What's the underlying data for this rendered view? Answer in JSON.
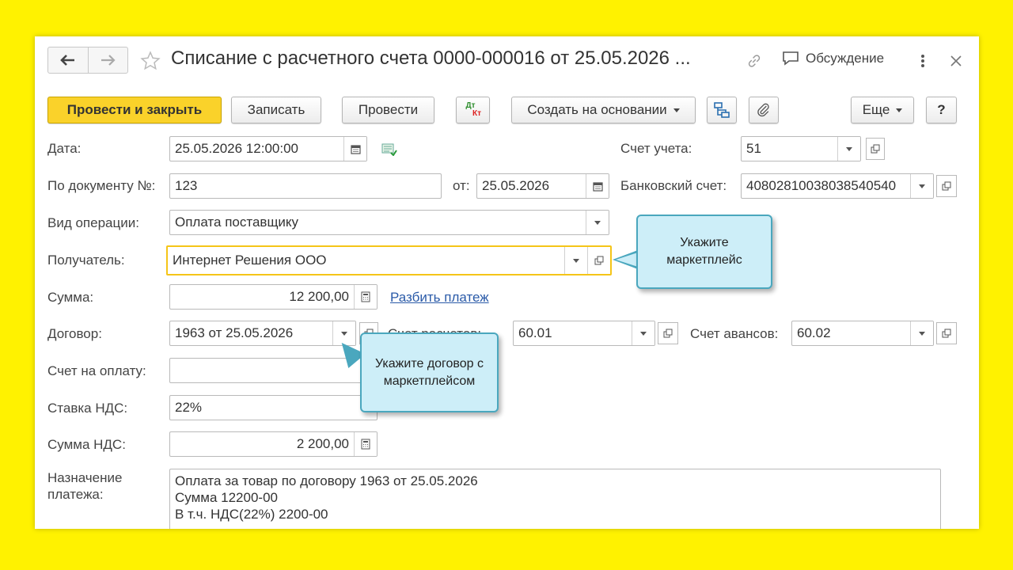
{
  "window": {
    "title": "Списание с расчетного счета 0000-000016 от 25.05.2026 ...",
    "discussion_label": "Обсуждение"
  },
  "toolbar": {
    "post_and_close": "Провести и закрыть",
    "save": "Записать",
    "post": "Провести",
    "dt_label": "Дт",
    "kt_label": "Кт",
    "create_based_on": "Создать на основании",
    "more": "Еще",
    "help": "?"
  },
  "form": {
    "date_label": "Дата:",
    "date_value": "25.05.2026 12:00:00",
    "account_label": "Счет учета:",
    "account_value": "51",
    "doc_number_label": "По документу №:",
    "doc_number_value": "123",
    "from_label": "от:",
    "from_value": "25.05.2026",
    "bank_account_label": "Банковский счет:",
    "bank_account_value": "40802810038038540540",
    "operation_label": "Вид операции:",
    "operation_value": "Оплата поставщику",
    "recipient_label": "Получатель:",
    "recipient_value": "Интернет Решения ООО",
    "amount_label": "Сумма:",
    "amount_value": "12 200,00",
    "split_payment_link": "Разбить платеж",
    "contract_label": "Договор:",
    "contract_value": "1963 от 25.05.2026",
    "settlement_account_label": "Счет расчетов:",
    "settlement_account_value": "60.01",
    "advance_account_label": "Счет авансов:",
    "advance_account_value": "60.02",
    "invoice_label": "Счет на оплату:",
    "invoice_value": "",
    "vat_rate_label": "Ставка НДС:",
    "vat_rate_value": "22%",
    "vat_amount_label": "Сумма НДС:",
    "vat_amount_value": "2 200,00",
    "purpose_label_line1": "Назначение",
    "purpose_label_line2": "платежа:",
    "purpose_line1": "Оплата за товар по договору 1963 от 25.05.2026",
    "purpose_line2": "Сумма 12200-00",
    "purpose_line3": "В т.ч. НДС(22%) 2200-00"
  },
  "callouts": {
    "marketplace_line1": "Укажите",
    "marketplace_line2": "маркетплейс",
    "contract_line1": "Укажите договор с",
    "contract_line2": "маркетплейсом"
  },
  "colors": {
    "background": "#fff200",
    "primary_button": "#fad22a",
    "focus_border": "#f5c518",
    "callout_fill": "#cdeef8",
    "callout_border": "#4aa7be",
    "link": "#2a5aa8"
  }
}
